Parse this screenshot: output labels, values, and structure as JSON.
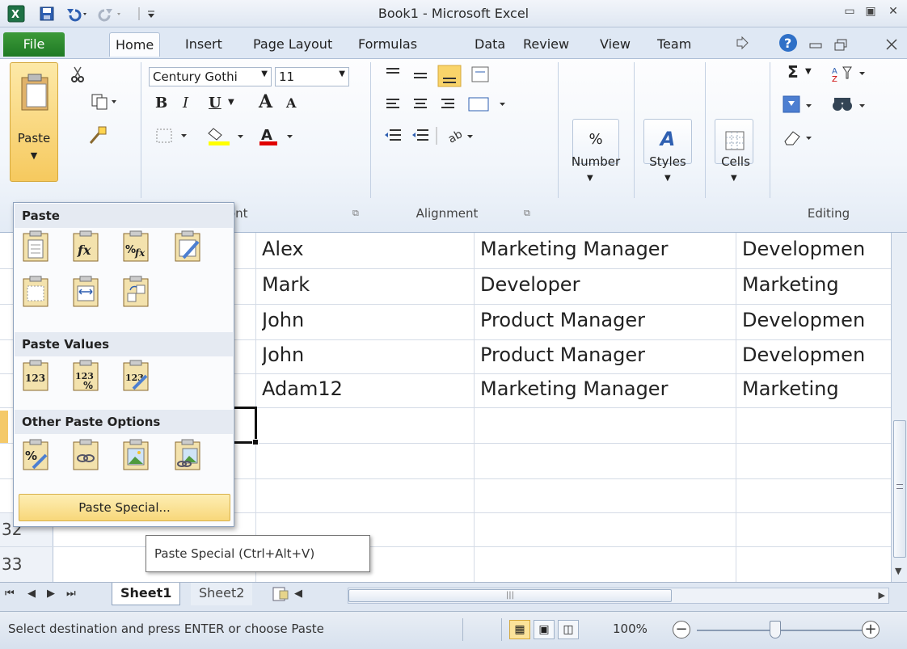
{
  "window": {
    "title": "Book1 - Microsoft Excel",
    "minimize_label": "▭",
    "restore_label": "▣",
    "close_label": "✕"
  },
  "ribbon_tabs": [
    "File",
    "Home",
    "Insert",
    "Page Layout",
    "Formulas",
    "Data",
    "Review",
    "View",
    "Team"
  ],
  "ribbon": {
    "clipboard": {
      "paste_label": "Paste"
    },
    "font": {
      "name": "Century Gothi",
      "size": "11",
      "bold": "B",
      "italic": "I",
      "underline": "U",
      "grow": "A",
      "shrink": "A",
      "font_color": "A",
      "group_label": "ont"
    },
    "alignment": {
      "group_label": "Alignment"
    },
    "number": {
      "label": "Number",
      "symbol": "%"
    },
    "styles": {
      "label": "Styles",
      "symbol": "A"
    },
    "cells": {
      "label": "Cells"
    },
    "editing": {
      "group_label": "Editing",
      "sum_symbol": "Σ"
    }
  },
  "grid": {
    "rows": [
      {
        "header": "",
        "c1": "Alex",
        "c2": "Marketing Manager",
        "c3": "Developmen"
      },
      {
        "header": "",
        "c1": "Mark",
        "c2": "Developer",
        "c3": "Marketing"
      },
      {
        "header": "",
        "c1": "John",
        "c2": "Product Manager",
        "c3": "Developmen"
      },
      {
        "header": "",
        "c1": "John",
        "c2": "Product Manager",
        "c3": "Developmen"
      },
      {
        "header": "",
        "c1": "Adam12",
        "c2": "Marketing Manager",
        "c3": "Marketing"
      },
      {
        "header": "",
        "c1": "",
        "c2": "",
        "c3": ""
      },
      {
        "header": "",
        "c1": "",
        "c2": "",
        "c3": ""
      },
      {
        "header": "",
        "c1": "",
        "c2": "",
        "c3": ""
      },
      {
        "header": "32",
        "c1": "",
        "c2": "",
        "c3": ""
      },
      {
        "header": "33",
        "c1": "",
        "c2": "",
        "c3": ""
      }
    ]
  },
  "paste_menu": {
    "section_paste": "Paste",
    "section_values": "Paste Values",
    "section_other": "Other Paste Options",
    "paste_special_label": "Paste Special...",
    "value_icon_text": "123",
    "formula_icon_text": "fx"
  },
  "tooltip": "Paste Special (Ctrl+Alt+V)",
  "sheets": [
    "Sheet1",
    "Sheet2"
  ],
  "status": {
    "message": "Select destination and press ENTER or choose Paste",
    "zoom": "100%"
  }
}
